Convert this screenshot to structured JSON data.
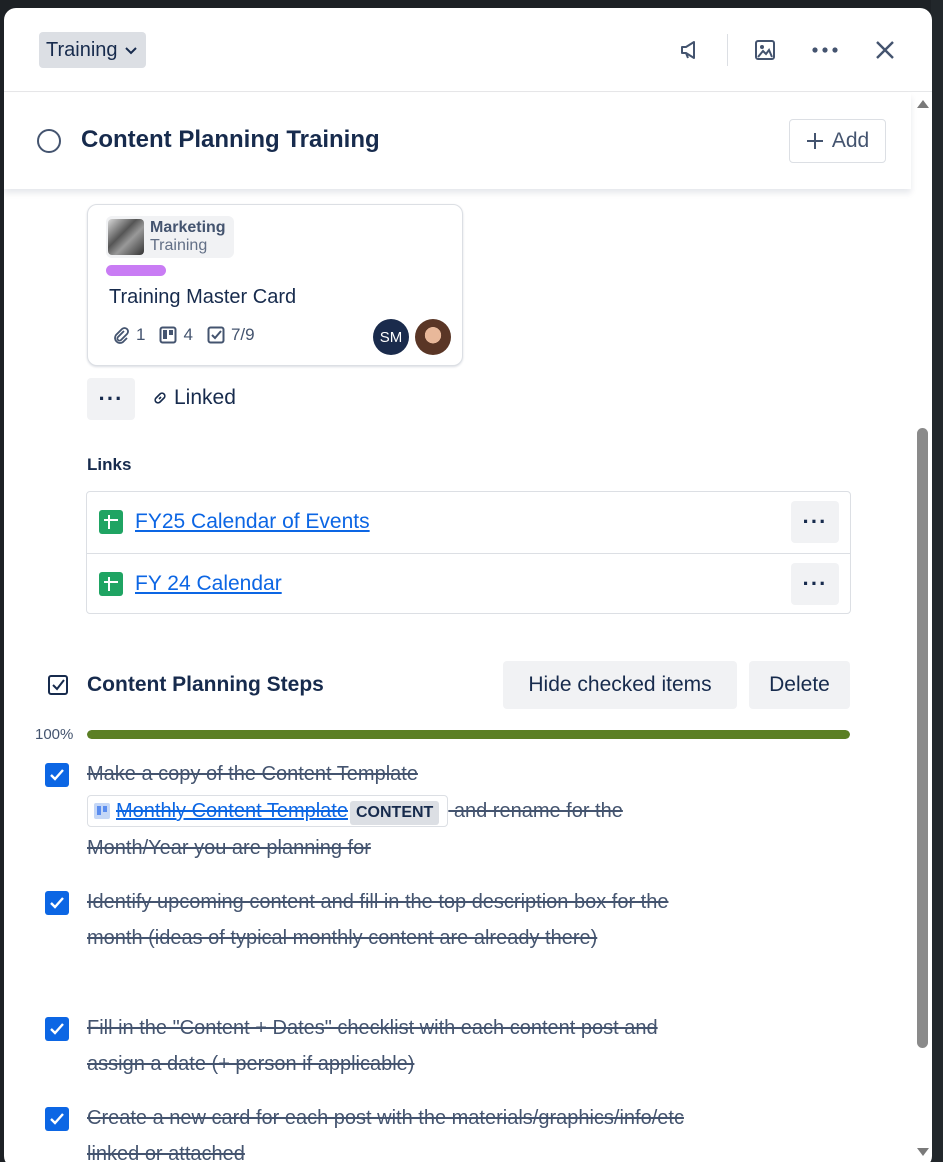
{
  "header": {
    "list_name": "Training"
  },
  "card": {
    "title": "Content Planning Training",
    "add_label": "Add"
  },
  "linked_card": {
    "workspace": "Marketing",
    "board": "Training",
    "label_color": "#c97cf4",
    "title": "Training Master Card",
    "attachments": "1",
    "boards_count": "4",
    "checklist": "7/9",
    "member_initials": "SM",
    "linked_label": "Linked",
    "more_label": "···"
  },
  "links": {
    "heading": "Links",
    "items": [
      {
        "label": "FY25 Calendar of Events",
        "more": "···"
      },
      {
        "label": "FY 24 Calendar",
        "more": "···"
      }
    ]
  },
  "checklist": {
    "title": "Content Planning Steps",
    "hide_label": "Hide checked items",
    "delete_label": "Delete",
    "percent_label": "100%",
    "progress": 1.0,
    "progress_color": "#5b7f24",
    "items": [
      {
        "text_before": "Make a copy of the Content Template ",
        "link": "Monthly Content Template",
        "tag": "CONTENT",
        "text_after": " and rename for the Month/Year you are planning for",
        "checked": true
      },
      {
        "text": "Identify upcoming content and fill in the top description box for the month (ideas of typical monthly content are already there)",
        "checked": true
      },
      {
        "text": "Fill in the \"Content + Dates\" checklist with each content post and assign a date (+ person if applicable)",
        "checked": true
      },
      {
        "text": "Create a new card for each post with the materials/graphics/info/etc linked or attached",
        "checked": true
      }
    ]
  }
}
